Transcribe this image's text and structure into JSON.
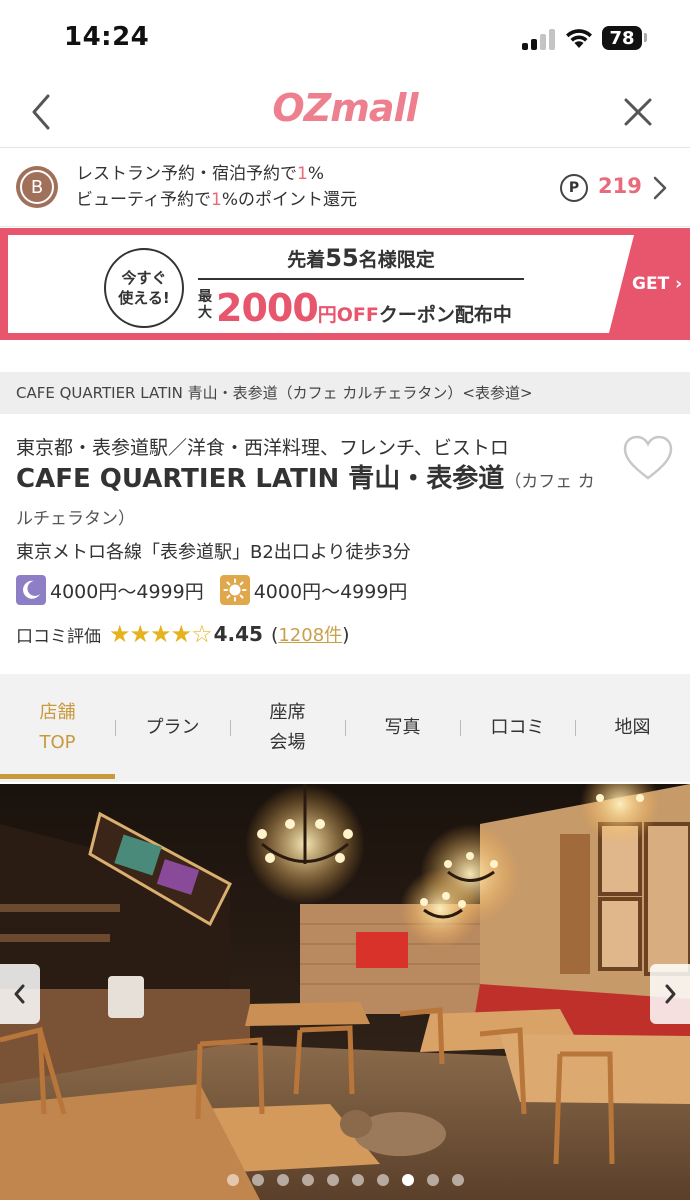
{
  "status_bar": {
    "time": "14:24",
    "battery": "78"
  },
  "header": {
    "logo": "OZmall"
  },
  "points": {
    "badge": "B",
    "line1_a": "レストラン予約・宿泊予約で",
    "line1_b": "1",
    "line1_c": "%",
    "line2_a": "ビューティ予約で",
    "line2_b": "1",
    "line2_c": "%のポイント還元",
    "icon_letter": "P",
    "value": "219"
  },
  "coupon": {
    "circle_line1": "今すぐ",
    "circle_line2": "使える!",
    "top_a": "先着",
    "top_num": "55",
    "top_b": "名様限定",
    "small_a": "最",
    "small_b": "大",
    "amount": "2000",
    "off": "円OFF",
    "rest": "クーポン配布中",
    "get": "GET",
    "colors": {
      "accent": "#e8566e"
    }
  },
  "breadcrumb": "CAFE QUARTIER LATIN 青山・表参道（カフェ カルチェラタン）<表参道>",
  "restaurant": {
    "category": "東京都・表参道駅／洋食・西洋料理、フレンチ、ビストロ",
    "name": "CAFE QUARTIER LATIN 青山・表参道",
    "kana": "（カフェ カルチェラタン）",
    "access": "東京メトロ各線「表参道駅」B2出口より徒歩3分",
    "dinner_price": "4000円～4999円",
    "lunch_price": "4000円～4999円",
    "review_label": "口コミ評価",
    "stars_filled": "★★★★",
    "stars_empty": "☆",
    "rating": "4.45",
    "review_open": "(",
    "review_count": "1208件",
    "review_close": ")"
  },
  "tabs": [
    {
      "line1": "店舗",
      "line2": "TOP"
    },
    {
      "line1": "プラン",
      "line2": ""
    },
    {
      "line1": "座席",
      "line2": "会場"
    },
    {
      "line1": "写真",
      "line2": ""
    },
    {
      "line1": "口コミ",
      "line2": ""
    },
    {
      "line1": "地図",
      "line2": ""
    }
  ],
  "carousel": {
    "active_dot": 7,
    "dot_count": 10
  }
}
